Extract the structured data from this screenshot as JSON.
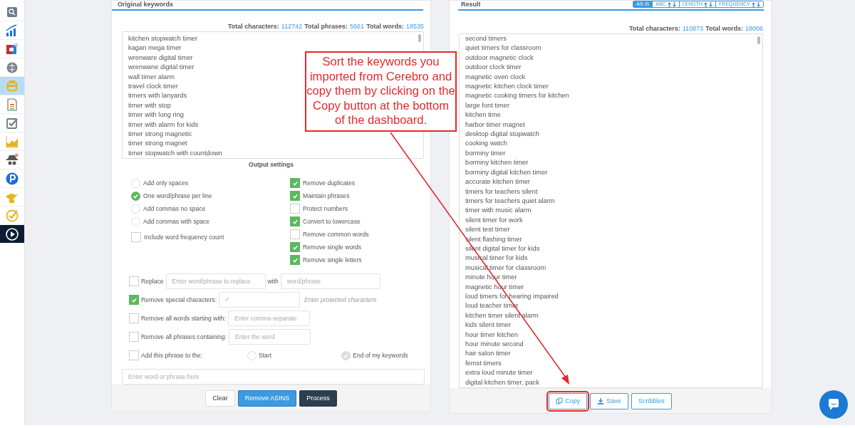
{
  "sidebar": {
    "items": [
      {
        "kind": "cube",
        "selected": false
      },
      {
        "kind": "bar-chart",
        "selected": false
      },
      {
        "kind": "puzzle",
        "selected": false
      },
      {
        "kind": "brain",
        "selected": false
      },
      {
        "kind": "robot",
        "selected": true
      },
      {
        "kind": "document",
        "selected": false
      },
      {
        "kind": "checkbox",
        "selected": false
      },
      {
        "kind": "area-chart",
        "selected": false
      },
      {
        "kind": "spy",
        "selected": false
      },
      {
        "kind": "parking",
        "selected": false
      },
      {
        "kind": "lamp",
        "selected": false
      },
      {
        "kind": "check-circle",
        "selected": false
      },
      {
        "kind": "play",
        "selected": false
      }
    ]
  },
  "original": {
    "title": "Original keywords",
    "stats": [
      {
        "label": "Total characters:",
        "value": "112742"
      },
      {
        "label": "Total phrases:",
        "value": "5661"
      },
      {
        "label": "Total words:",
        "value": "18535"
      }
    ],
    "keywords": [
      "kitchen stopwatch timer",
      "kagan mega timer",
      "wrenware digital timer",
      "wrenwane digital timer",
      "wall timer alarm",
      "travel clock timer",
      "timers with lanyards",
      "timer with stop",
      "timer with long ring",
      "timer with alarm for kids",
      "timer strong magnetic",
      "timer strong magnet",
      "timer stopwatch with countdown"
    ],
    "settings_title": "Output settings",
    "radios": [
      {
        "label": "Add only spaces",
        "selected": false
      },
      {
        "label": "One word/phrase per line",
        "selected": true
      },
      {
        "label": "Add commas no space",
        "selected": false
      },
      {
        "label": "Add commas with space",
        "selected": false
      }
    ],
    "frequency": {
      "label": "Include word frequency count",
      "checked": false
    },
    "checkboxes": [
      {
        "label": "Remove duplicates",
        "checked": true
      },
      {
        "label": "Maintain phrases",
        "checked": true
      },
      {
        "label": "Protect numbers",
        "checked": false
      },
      {
        "label": "Convert to lowercase",
        "checked": true
      },
      {
        "label": "Remove common words",
        "checked": false
      },
      {
        "label": "Remove single words",
        "checked": true
      },
      {
        "label": "Remove single letters",
        "checked": true
      }
    ],
    "replace": {
      "label": "Replace",
      "checked": false,
      "placeholder": "Enter word/phrase to replace",
      "with_label": "with",
      "with_placeholder": "word/phrase"
    },
    "special": {
      "label": "Remove special characters:",
      "checked": true,
      "value": "-'",
      "hint": "Enter protected characters"
    },
    "remove_words": {
      "label": "Remove all words starting with:",
      "checked": false,
      "placeholder": "Enter comma-separate"
    },
    "remove_phrases": {
      "label": "Remove all phrases containing:",
      "checked": false,
      "placeholder": "Enter the word"
    },
    "add_phrase": {
      "label": "Add this phrase to the:",
      "checked": false,
      "options": [
        {
          "label": "Start",
          "selected": false
        },
        {
          "label": "End of my keywords",
          "selected": true
        }
      ],
      "placeholder": "Enter word or phrase here"
    },
    "buttons": [
      {
        "label": "Clear",
        "kind": "default"
      },
      {
        "label": "Remove ASINS",
        "kind": "primary"
      },
      {
        "label": "Process",
        "kind": "dark"
      }
    ]
  },
  "result": {
    "title": "Result",
    "sort_buttons": [
      {
        "label": "AS IS",
        "selected": true,
        "arrows": false
      },
      {
        "label": "ABC",
        "selected": false,
        "arrows": true
      },
      {
        "label": "LENGTH",
        "selected": false,
        "arrows": true
      },
      {
        "label": "FREQUENCY",
        "selected": false,
        "arrows": true
      }
    ],
    "stats": [
      {
        "label": "Total characters:",
        "value": "110873"
      },
      {
        "label": "Total words:",
        "value": "18006"
      }
    ],
    "keywords": [
      "second timers",
      "quiet timers for classroom",
      "outdoor magnetic clock",
      "outdoor clock timer",
      "magnetic oven clock",
      "magnetic kitchen clock timer",
      "magnetic cooking timers for kitchen",
      "large font timer",
      "kitchen time",
      "harbor timer magnet",
      "desktop digital stopwatch",
      "cooking watch",
      "borminy timer",
      "borminy kitchen timer",
      "borminy digital kitchen timer",
      "accurate kitchen timer",
      "timers for teachers silent",
      "timers for teachers quiet alarm",
      "timer with music alarm",
      "silent timer for work",
      "silent test timer",
      "silent flashing timer",
      "silent digital timer for kids",
      "musical timer for kids",
      "musical timer for classroom",
      "minute hour timer",
      "magnetic hour timer",
      "loud timers for hearing impaired",
      "loud teacher timer",
      "kitchen timer silent alarm",
      "kids silent timer",
      "hour timer kitchen",
      "hour minute second",
      "hair salon timer",
      "femst timers",
      "extra loud minute timer",
      "digital kitchen timer, pack"
    ],
    "buttons": [
      {
        "label": "Copy",
        "kind": "copy",
        "highlighted": true
      },
      {
        "label": "Save",
        "kind": "save",
        "highlighted": false
      },
      {
        "label": "Scribbles",
        "kind": "plain",
        "highlighted": false
      }
    ]
  },
  "annotation": {
    "text": "Sort the keywords you imported from Cerebro and copy them by clicking on the Copy button at the bottom of the dashboard."
  }
}
